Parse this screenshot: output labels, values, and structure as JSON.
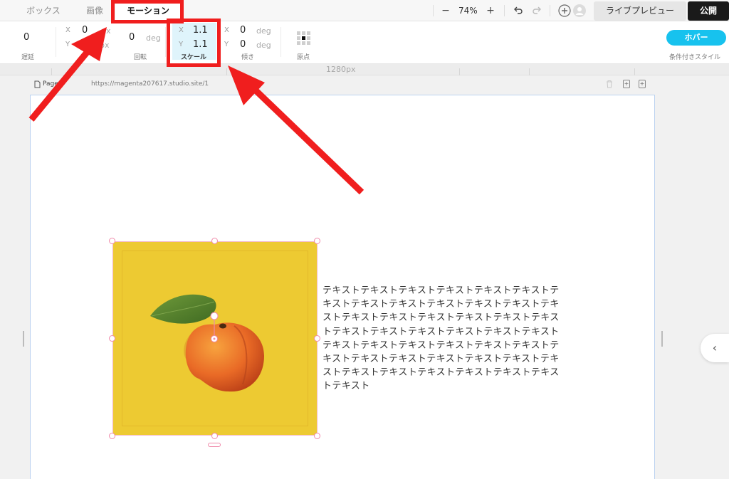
{
  "topbar": {
    "tabs": [
      {
        "label": "ボックス",
        "active": false
      },
      {
        "label": "画像",
        "active": false
      },
      {
        "label": "モーション",
        "active": true
      }
    ],
    "zoom_out_label": "−",
    "zoom_level": "74%",
    "zoom_in_label": "+",
    "undo_icon": "undo-icon",
    "redo_icon": "redo-icon",
    "add_icon": "add-circle-icon",
    "avatar_icon": "user-avatar-icon",
    "live_preview_label": "ライブプレビュー",
    "publish_label": "公開"
  },
  "properties": {
    "delay": {
      "value": "0",
      "label": "遅延"
    },
    "translate": {
      "x_axis": "X",
      "x_value": "0",
      "x_unit": "px",
      "y_axis": "Y",
      "y_value": "0",
      "y_unit": "px"
    },
    "rotate": {
      "value": "0",
      "unit": "deg",
      "label": "回転"
    },
    "scale": {
      "x_axis": "X",
      "x_value": "1.1",
      "y_axis": "Y",
      "y_value": "1.1",
      "label": "スケール"
    },
    "skew": {
      "x_axis": "X",
      "x_value": "0",
      "x_unit": "deg",
      "y_axis": "Y",
      "y_value": "0",
      "y_unit": "deg",
      "label": "傾き"
    },
    "origin": {
      "label": "原点"
    },
    "hover_label": "ホバー",
    "conditional_style_label": "条件付きスタイル"
  },
  "ruler": {
    "width_label": "1280px"
  },
  "page": {
    "name": "Page",
    "url": "https://magenta207617.studio.site/1",
    "delete_icon": "trash-icon",
    "add_above_icon": "add-section-above-icon",
    "add_below_icon": "add-section-below-icon"
  },
  "content": {
    "image_alt": "apricot-image",
    "text": "テキストテキストテキストテキストテキストテキストテキストテキストテキストテキストテキストテキストテキストテキストテキストテキストテキストテキストテキストテキストテキストテキストテキストテキストテキストテキストテキストテキストテキストテキストテキストテキストテキストテキストテキストテキストテキストテキストテキストテキストテキストテキストテキストテキストテキスト"
  },
  "side_panel": {
    "collapse_icon": "chevron-left-icon"
  },
  "colors": {
    "accent": "#17c2ee",
    "annotation": "#f01e1e",
    "image_background": "#edca32",
    "selection": "#f08aaa",
    "publish": "#1a1a1a"
  }
}
